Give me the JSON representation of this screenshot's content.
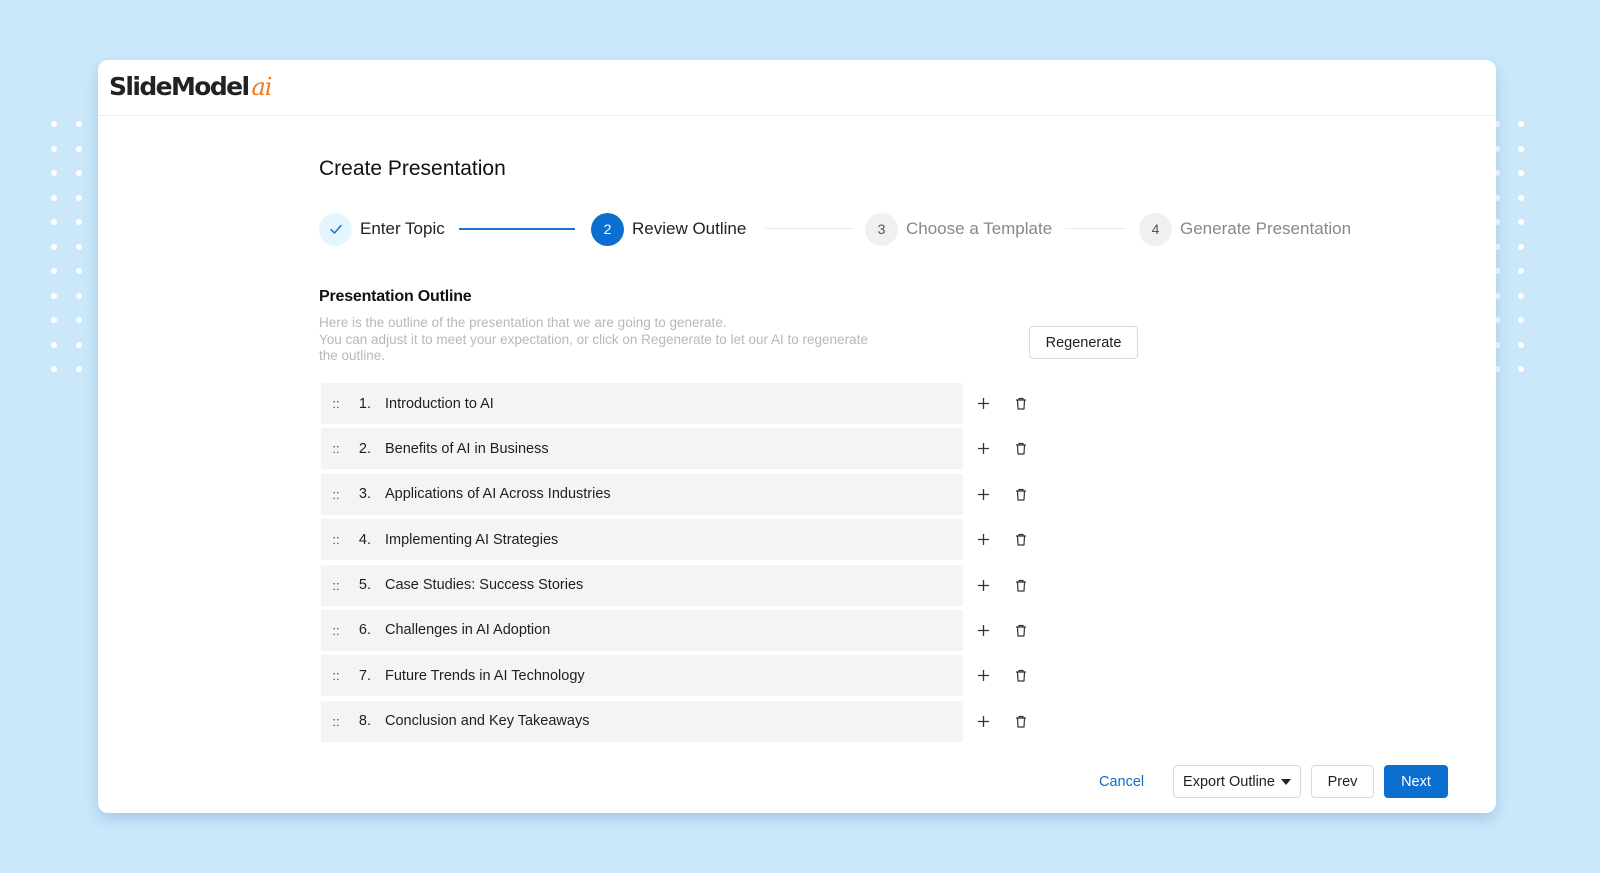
{
  "brand": {
    "name": "SlideModel",
    "suffix": "ai",
    "accent_color": "#f07c1e"
  },
  "colors": {
    "primary": "#0a6fce",
    "background": "#cbe8fb",
    "row_background": "#f4f4f4"
  },
  "page": {
    "title": "Create Presentation"
  },
  "stepper": {
    "steps": [
      {
        "number": "1",
        "label": "Enter Topic",
        "status": "done",
        "icon": "check-icon"
      },
      {
        "number": "2",
        "label": "Review Outline",
        "status": "active"
      },
      {
        "number": "3",
        "label": "Choose a Template",
        "status": "pending"
      },
      {
        "number": "4",
        "label": "Generate Presentation",
        "status": "pending"
      }
    ]
  },
  "outline": {
    "title": "Presentation Outline",
    "description_line1": "Here is the outline of the presentation that we are going to generate.",
    "description_line2": "You can adjust it to meet your expectation, or click on Regenerate to let our AI to regenerate the outline.",
    "regenerate_label": "Regenerate",
    "drag_handle": "::",
    "items": [
      {
        "number": "1.",
        "title": "Introduction to AI"
      },
      {
        "number": "2.",
        "title": "Benefits of AI in Business"
      },
      {
        "number": "3.",
        "title": "Applications of AI Across Industries"
      },
      {
        "number": "4.",
        "title": "Implementing AI Strategies"
      },
      {
        "number": "5.",
        "title": "Case Studies: Success Stories"
      },
      {
        "number": "6.",
        "title": "Challenges in AI Adoption"
      },
      {
        "number": "7.",
        "title": "Future Trends in AI Technology"
      },
      {
        "number": "8.",
        "title": "Conclusion and Key Takeaways"
      }
    ],
    "row_icons": [
      "plus-icon",
      "trash-icon"
    ]
  },
  "footer": {
    "cancel_label": "Cancel",
    "export_label": "Export Outline",
    "prev_label": "Prev",
    "next_label": "Next"
  }
}
